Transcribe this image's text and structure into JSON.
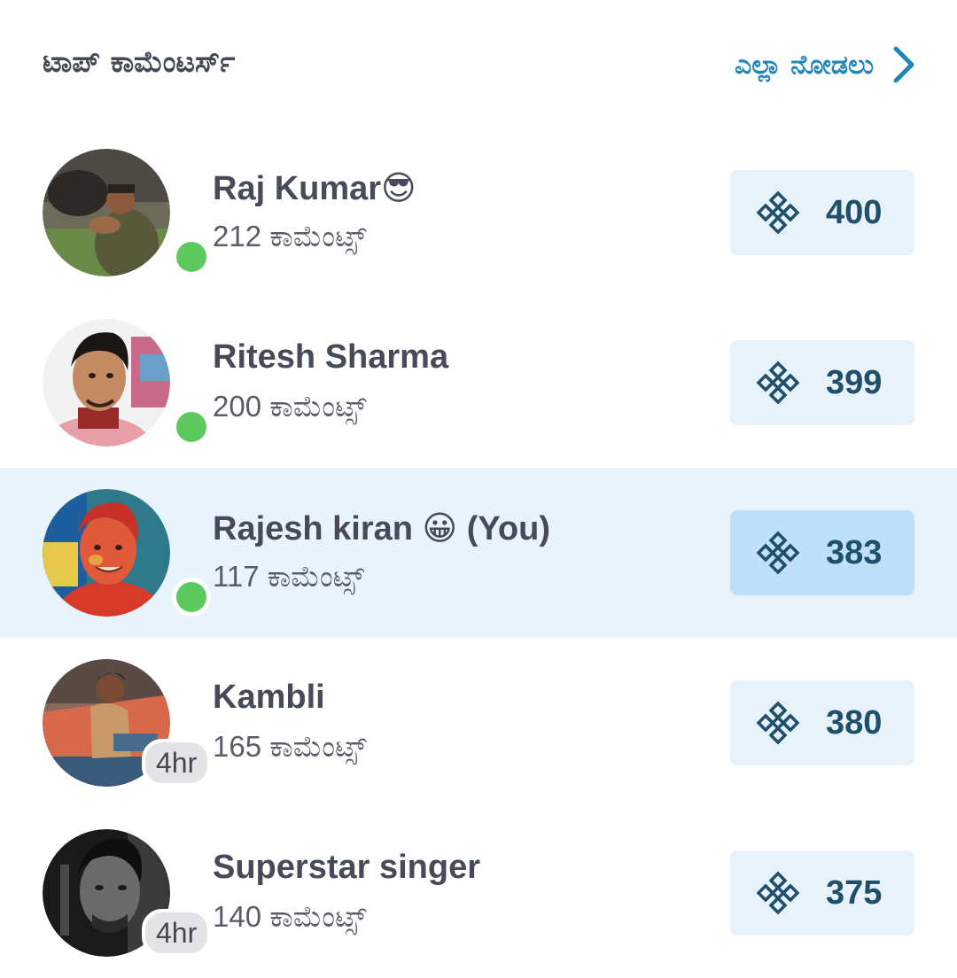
{
  "header": {
    "title": "ಟಾಪ್ ಕಾಮೆಂಟರ್ಸ್",
    "see_all_label": "ಎಲ್ಲಾ ನೋಡಲು",
    "see_all_icon": "chevron-right-icon"
  },
  "score_icon": "endless-knot-icon",
  "colors": {
    "accent": "#1f86bb",
    "online": "#5ec95f",
    "score_bg": "#e8f2fa",
    "score_bg_self": "#bfe0fa",
    "highlight_row": "#e9f3fc",
    "score_text": "#1f4f6b"
  },
  "commenters": [
    {
      "name": "Raj Kumar😎",
      "comments": "212 ಕಾಮೆಂಟ್ಸ್",
      "score": "400",
      "status": "online"
    },
    {
      "name": "Ritesh Sharma",
      "comments": "200 ಕಾಮೆಂಟ್ಸ್",
      "score": "399",
      "status": "online"
    },
    {
      "name": "Rajesh kiran 😀 (You)",
      "comments": "117 ಕಾಮೆಂಟ್ಸ್",
      "score": "383",
      "status": "online",
      "is_self": true
    },
    {
      "name": "Kambli",
      "comments": "165 ಕಾಮೆಂಟ್ಸ್",
      "score": "380",
      "status": "away",
      "last_seen": "4hr"
    },
    {
      "name": "Superstar singer",
      "comments": "140 ಕಾಮೆಂಟ್ಸ್",
      "score": "375",
      "status": "away",
      "last_seen": "4hr"
    }
  ]
}
